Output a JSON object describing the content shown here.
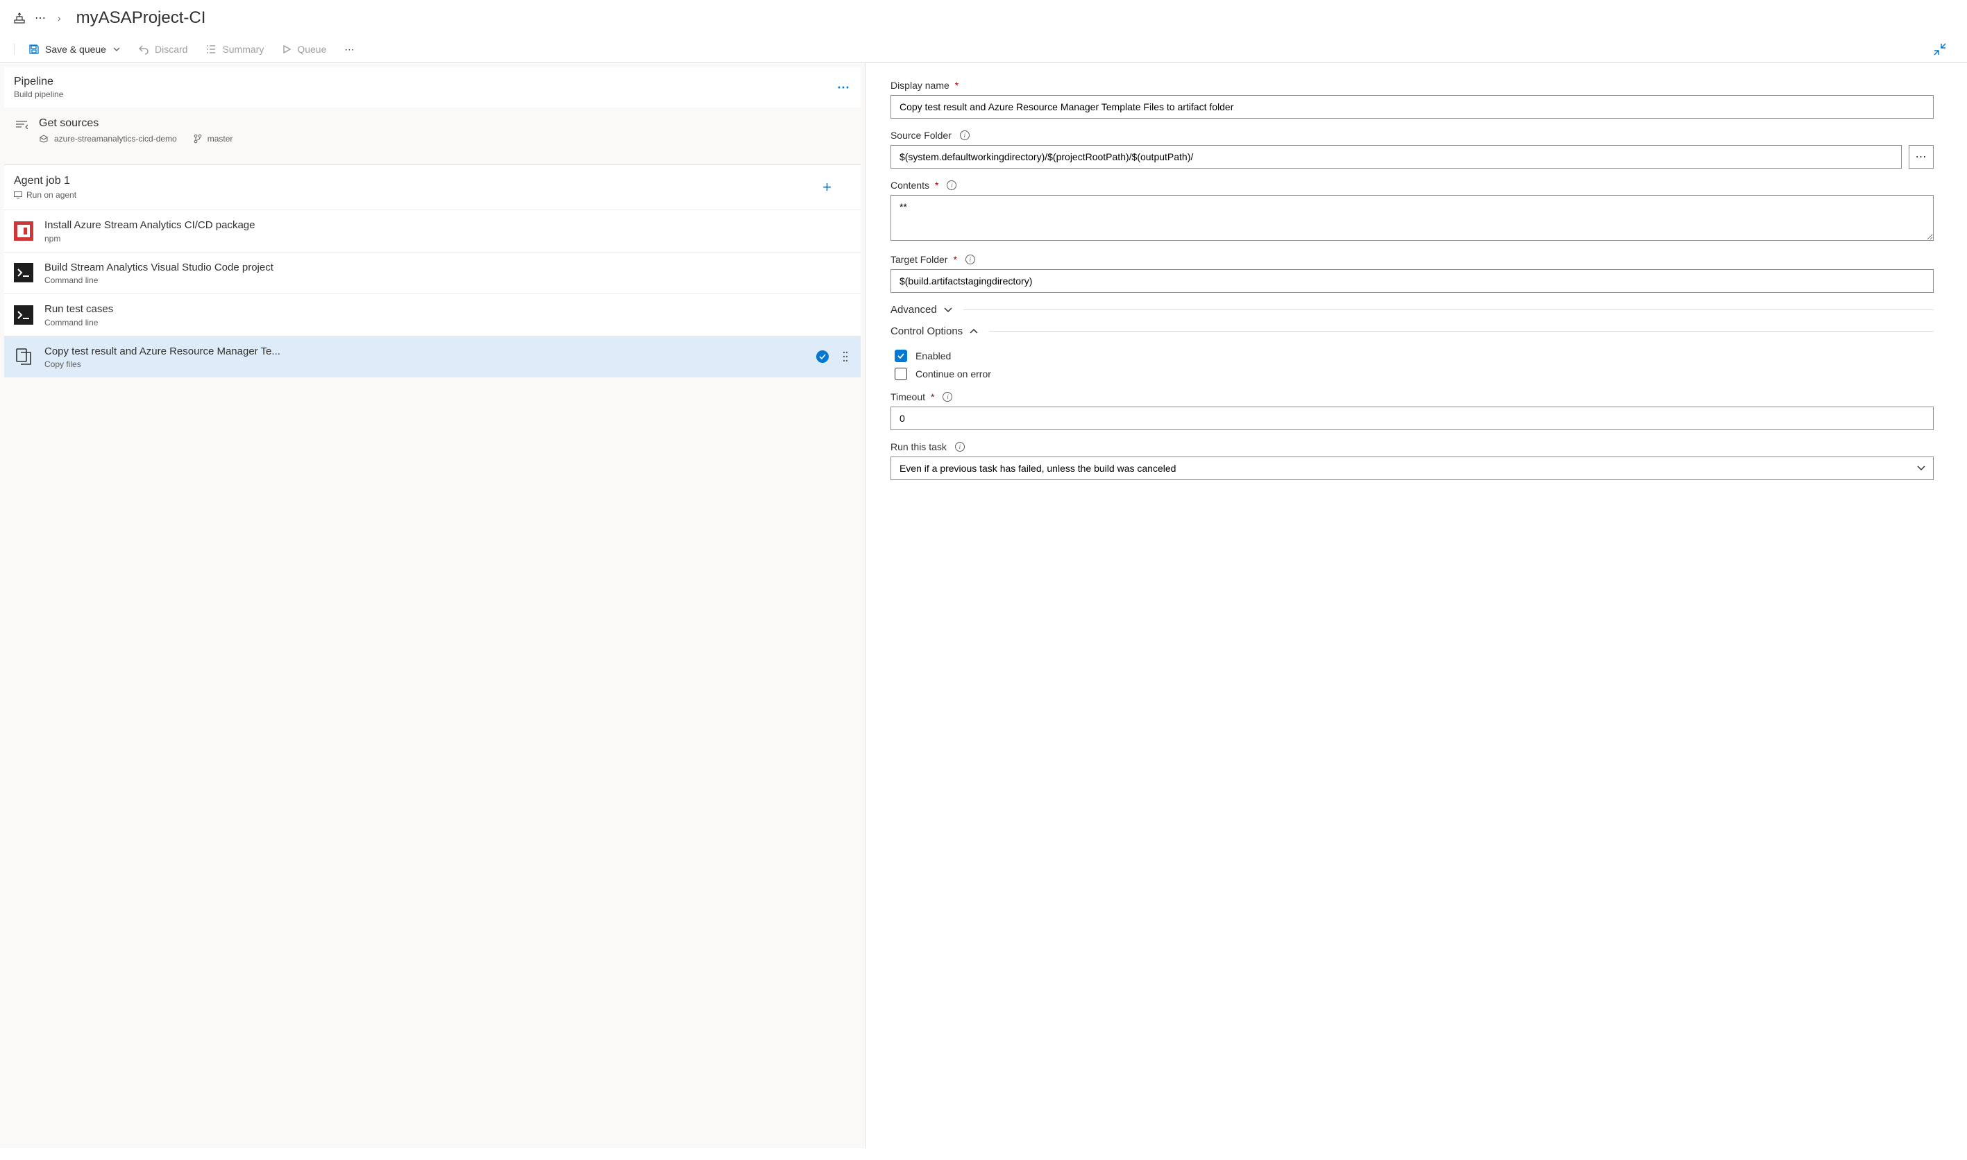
{
  "breadcrumb": {
    "title": "myASAProject-CI"
  },
  "toolbar": {
    "save_queue": "Save & queue",
    "discard": "Discard",
    "summary": "Summary",
    "queue": "Queue"
  },
  "pipeline": {
    "title": "Pipeline",
    "subtitle": "Build pipeline"
  },
  "get_sources": {
    "title": "Get sources",
    "repo": "azure-streamanalytics-cicd-demo",
    "branch": "master"
  },
  "agent_job": {
    "title": "Agent job 1",
    "subtitle": "Run on agent"
  },
  "tasks": [
    {
      "title": "Install Azure Stream Analytics CI/CD package",
      "subtitle": "npm",
      "icon": "npm"
    },
    {
      "title": "Build Stream Analytics Visual Studio Code project",
      "subtitle": "Command line",
      "icon": "cmd"
    },
    {
      "title": "Run test cases",
      "subtitle": "Command line",
      "icon": "cmd"
    },
    {
      "title": "Copy test result and Azure Resource Manager Te...",
      "subtitle": "Copy files",
      "icon": "copy"
    }
  ],
  "form": {
    "display_name_label": "Display name",
    "display_name_value": "Copy test result and Azure Resource Manager Template Files to artifact folder",
    "source_folder_label": "Source Folder",
    "source_folder_value": "$(system.defaultworkingdirectory)/$(projectRootPath)/$(outputPath)/",
    "contents_label": "Contents",
    "contents_value": "**",
    "target_folder_label": "Target Folder",
    "target_folder_value": "$(build.artifactstagingdirectory)",
    "advanced": "Advanced",
    "control_options": "Control Options",
    "enabled_label": "Enabled",
    "continue_on_error_label": "Continue on error",
    "enabled_checked": true,
    "continue_on_error_checked": false,
    "timeout_label": "Timeout",
    "timeout_value": "0",
    "run_this_task_label": "Run this task",
    "run_this_task_value": "Even if a previous task has failed, unless the build was canceled"
  }
}
